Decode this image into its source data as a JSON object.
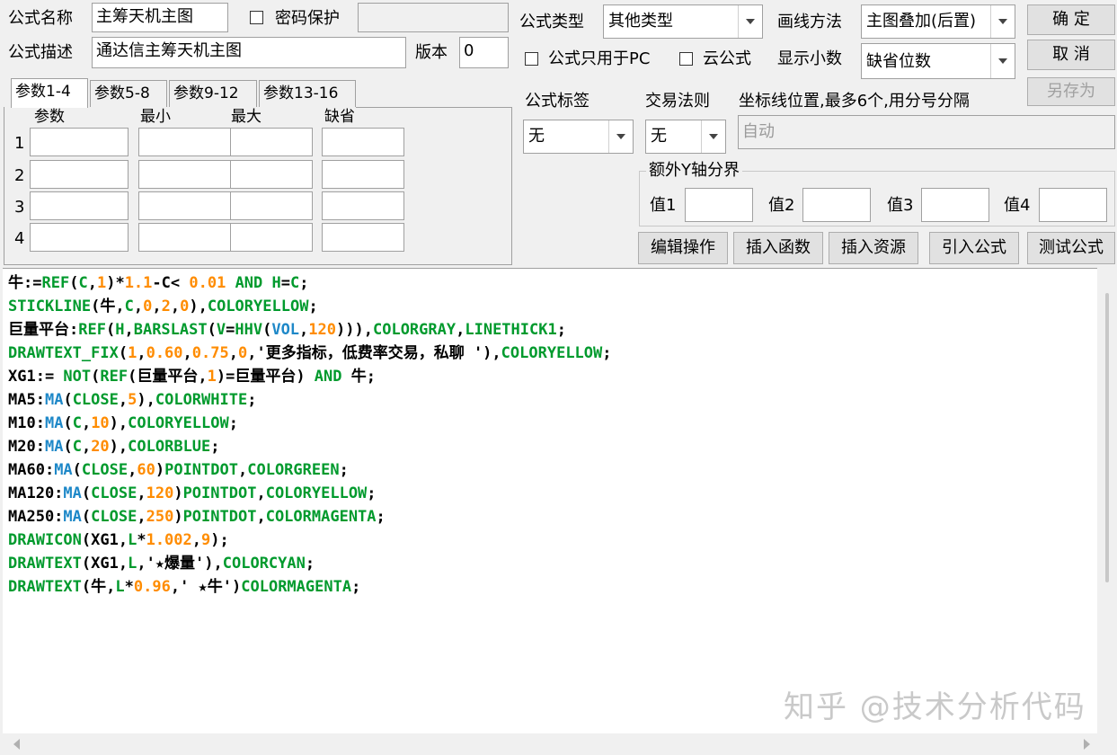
{
  "colors": {
    "keyword": "#009a2d",
    "function": "#1e88c8",
    "number": "#ff8c00",
    "text": "#000000",
    "watermark": "#c9c9c9"
  },
  "form": {
    "name_label": "公式名称",
    "name_value": "主筹天机主图",
    "password_label": "密码保护",
    "desc_label": "公式描述",
    "desc_value": "通达信主筹天机主图",
    "version_label": "版本",
    "version_value": "0",
    "type_label": "公式类型",
    "type_value": "其他类型",
    "draw_label": "画线方法",
    "draw_value": "主图叠加(后置)",
    "pc_only_label": "公式只用于PC",
    "cloud_label": "云公式",
    "decimals_label": "显示小数",
    "decimals_value": "缺省位数",
    "tag_label": "公式标签",
    "tag_value": "无",
    "rule_label": "交易法则",
    "rule_value": "无",
    "coord_label": "坐标线位置,最多6个,用分号分隔",
    "coord_value": "自动",
    "yaxis_label": "额外Y轴分界",
    "val1": "值1",
    "val2": "值2",
    "val3": "值3",
    "val4": "值4"
  },
  "buttons": {
    "ok": "确  定",
    "cancel": "取  消",
    "saveas": "另存为",
    "edit": "编辑操作",
    "insert_func": "插入函数",
    "insert_res": "插入资源",
    "import": "引入公式",
    "test": "测试公式"
  },
  "params": {
    "tabs": [
      "参数1-4",
      "参数5-8",
      "参数9-12",
      "参数13-16"
    ],
    "headers": [
      "参数",
      "最小",
      "最大",
      "缺省"
    ],
    "rows": [
      "1",
      "2",
      "3",
      "4"
    ]
  },
  "code_lines": [
    [
      [
        "t",
        "牛:="
      ],
      [
        "k",
        "REF"
      ],
      [
        "t",
        "("
      ],
      [
        "k",
        "C"
      ],
      [
        "t",
        ","
      ],
      [
        "n",
        "1"
      ],
      [
        "t",
        ")*"
      ],
      [
        "n",
        "1.1"
      ],
      [
        "t",
        "-C< "
      ],
      [
        "n",
        "0.01"
      ],
      [
        "t",
        " "
      ],
      [
        "k",
        "AND"
      ],
      [
        "t",
        " "
      ],
      [
        "k",
        "H"
      ],
      [
        "t",
        "="
      ],
      [
        "k",
        "C"
      ],
      [
        "t",
        ";"
      ]
    ],
    [
      [
        "k",
        "STICKLINE"
      ],
      [
        "t",
        "(牛,"
      ],
      [
        "k",
        "C"
      ],
      [
        "t",
        ","
      ],
      [
        "n",
        "0"
      ],
      [
        "t",
        ","
      ],
      [
        "n",
        "2"
      ],
      [
        "t",
        ","
      ],
      [
        "n",
        "0"
      ],
      [
        "t",
        "),"
      ],
      [
        "k",
        "COLORYELLOW"
      ],
      [
        "t",
        ";"
      ]
    ],
    [
      [
        "t",
        "巨量平台:"
      ],
      [
        "k",
        "REF"
      ],
      [
        "t",
        "("
      ],
      [
        "k",
        "H"
      ],
      [
        "t",
        ","
      ],
      [
        "k",
        "BARSLAST"
      ],
      [
        "t",
        "("
      ],
      [
        "k",
        "V"
      ],
      [
        "t",
        "="
      ],
      [
        "k",
        "HHV"
      ],
      [
        "t",
        "("
      ],
      [
        "f",
        "VOL"
      ],
      [
        "t",
        ","
      ],
      [
        "n",
        "120"
      ],
      [
        "t",
        ")))"
      ],
      [
        "t",
        ","
      ],
      [
        "k",
        "COLORGRAY"
      ],
      [
        "t",
        ","
      ],
      [
        "k",
        "LINETHICK1"
      ],
      [
        "t",
        ";"
      ]
    ],
    [
      [
        "k",
        "DRAWTEXT_FIX"
      ],
      [
        "t",
        "("
      ],
      [
        "n",
        "1"
      ],
      [
        "t",
        ","
      ],
      [
        "n",
        "0.60"
      ],
      [
        "t",
        ","
      ],
      [
        "n",
        "0.75"
      ],
      [
        "t",
        ","
      ],
      [
        "n",
        "0"
      ],
      [
        "t",
        ",'更多指标，低费率交易，私聊 ')"
      ],
      [
        "t",
        ","
      ],
      [
        "k",
        "COLORYELLOW"
      ],
      [
        "t",
        ";"
      ]
    ],
    [
      [
        "t",
        "XG1:= "
      ],
      [
        "k",
        "NOT"
      ],
      [
        "t",
        "("
      ],
      [
        "k",
        "REF"
      ],
      [
        "t",
        "(巨量平台,"
      ],
      [
        "n",
        "1"
      ],
      [
        "t",
        ")=巨量平台) "
      ],
      [
        "k",
        "AND"
      ],
      [
        "t",
        " 牛;"
      ]
    ],
    [
      [
        "t",
        "MA5:"
      ],
      [
        "f",
        "MA"
      ],
      [
        "t",
        "("
      ],
      [
        "k",
        "CLOSE"
      ],
      [
        "t",
        ","
      ],
      [
        "n",
        "5"
      ],
      [
        "t",
        "),"
      ],
      [
        "k",
        "COLORWHITE"
      ],
      [
        "t",
        ";"
      ]
    ],
    [
      [
        "t",
        "M10:"
      ],
      [
        "f",
        "MA"
      ],
      [
        "t",
        "("
      ],
      [
        "k",
        "C"
      ],
      [
        "t",
        ","
      ],
      [
        "n",
        "10"
      ],
      [
        "t",
        "),"
      ],
      [
        "k",
        "COLORYELLOW"
      ],
      [
        "t",
        ";"
      ]
    ],
    [
      [
        "t",
        "M20:"
      ],
      [
        "f",
        "MA"
      ],
      [
        "t",
        "("
      ],
      [
        "k",
        "C"
      ],
      [
        "t",
        ","
      ],
      [
        "n",
        "20"
      ],
      [
        "t",
        "),"
      ],
      [
        "k",
        "COLORBLUE"
      ],
      [
        "t",
        ";"
      ]
    ],
    [
      [
        "t",
        "MA60:"
      ],
      [
        "f",
        "MA"
      ],
      [
        "t",
        "("
      ],
      [
        "k",
        "CLOSE"
      ],
      [
        "t",
        ","
      ],
      [
        "n",
        "60"
      ],
      [
        "t",
        ")"
      ],
      [
        "k",
        "POINTDOT"
      ],
      [
        "t",
        ","
      ],
      [
        "k",
        "COLORGREEN"
      ],
      [
        "t",
        ";"
      ]
    ],
    [
      [
        "t",
        "MA120:"
      ],
      [
        "f",
        "MA"
      ],
      [
        "t",
        "("
      ],
      [
        "k",
        "CLOSE"
      ],
      [
        "t",
        ","
      ],
      [
        "n",
        "120"
      ],
      [
        "t",
        ")"
      ],
      [
        "k",
        "POINTDOT"
      ],
      [
        "t",
        ","
      ],
      [
        "k",
        "COLORYELLOW"
      ],
      [
        "t",
        ";"
      ]
    ],
    [
      [
        "t",
        "MA250:"
      ],
      [
        "f",
        "MA"
      ],
      [
        "t",
        "("
      ],
      [
        "k",
        "CLOSE"
      ],
      [
        "t",
        ","
      ],
      [
        "n",
        "250"
      ],
      [
        "t",
        ")"
      ],
      [
        "k",
        "POINTDOT"
      ],
      [
        "t",
        ","
      ],
      [
        "k",
        "COLORMAGENTA"
      ],
      [
        "t",
        ";"
      ]
    ],
    [
      [
        "k",
        "DRAWICON"
      ],
      [
        "t",
        "(XG1,"
      ],
      [
        "k",
        "L"
      ],
      [
        "t",
        "*"
      ],
      [
        "n",
        "1.002"
      ],
      [
        "t",
        ","
      ],
      [
        "n",
        "9"
      ],
      [
        "t",
        ");"
      ]
    ],
    [
      [
        "k",
        "DRAWTEXT"
      ],
      [
        "t",
        "(XG1,"
      ],
      [
        "k",
        "L"
      ],
      [
        "t",
        ",'★爆量'),"
      ],
      [
        "k",
        "COLORCYAN"
      ],
      [
        "t",
        ";"
      ]
    ],
    [
      [
        "k",
        "DRAWTEXT"
      ],
      [
        "t",
        "(牛,"
      ],
      [
        "k",
        "L"
      ],
      [
        "t",
        "*"
      ],
      [
        "n",
        "0.96"
      ],
      [
        "t",
        ",' ★牛')"
      ],
      [
        "k",
        "COLORMAGENTA"
      ],
      [
        "t",
        ";"
      ]
    ]
  ],
  "watermark": "知乎 @技术分析代码"
}
